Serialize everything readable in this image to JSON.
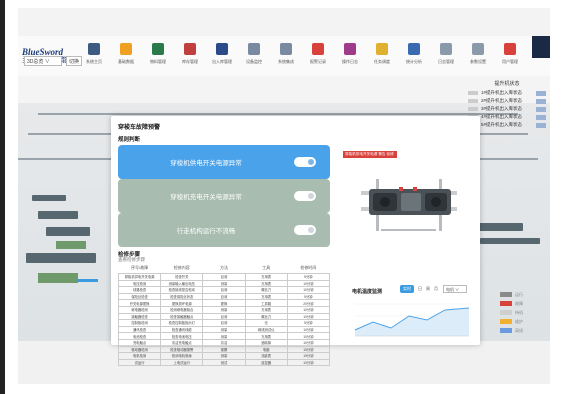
{
  "app": {
    "logo_line1": "BlueSword",
    "logo_line2": "兰 剑 智 能"
  },
  "toolbar": [
    {
      "label": "系统主页",
      "icon": "factory-icon",
      "color": "#3d5a80"
    },
    {
      "label": "基础数据",
      "icon": "sun-icon",
      "color": "#f0a020"
    },
    {
      "label": "物料管理",
      "icon": "tools-icon",
      "color": "#2a7a4a"
    },
    {
      "label": "库存管理",
      "icon": "wrench-icon",
      "color": "#c04040"
    },
    {
      "label": "出入库管理",
      "icon": "robot-icon",
      "color": "#2a4a8a"
    },
    {
      "label": "设备监控",
      "icon": "document-icon",
      "color": "#7a8aa0"
    },
    {
      "label": "系统集成",
      "icon": "file-icon",
      "color": "#7a8aa0"
    },
    {
      "label": "报警记录",
      "icon": "alert-icon",
      "color": "#d9413b"
    },
    {
      "label": "操作日志",
      "icon": "log-icon",
      "color": "#a03a8a"
    },
    {
      "label": "任务调度",
      "icon": "bulb-icon",
      "color": "#e0b030"
    },
    {
      "label": "统计分析",
      "icon": "grid-icon",
      "color": "#3a6ab0"
    },
    {
      "label": "日志管理",
      "icon": "page-icon",
      "color": "#8a9aaa"
    },
    {
      "label": "参数设置",
      "icon": "clipboard-icon",
      "color": "#8a9aaa"
    },
    {
      "label": "用户管理",
      "icon": "users-icon",
      "color": "#d9413b"
    }
  ],
  "selectors": {
    "scene": "3D总览",
    "view": "切换"
  },
  "legend_top": {
    "title": "提升机状态",
    "rows": [
      "1#提升机出入库状态",
      "2#提升机出入库状态",
      "3#提升机出入库状态",
      "4#提升机出入库状态",
      "5#提升机出入库状态"
    ]
  },
  "legend_bottom": [
    {
      "label": "运行",
      "color": "#8a8a8a"
    },
    {
      "label": "故障",
      "color": "#d9413b"
    },
    {
      "label": "待机",
      "color": "#cfcfcf"
    },
    {
      "label": "维护",
      "color": "#f0b030"
    },
    {
      "label": "离线",
      "color": "#6a9be0"
    }
  ],
  "modal": {
    "title": "穿梭车故障预警",
    "rules_title": "规则判断",
    "rules": [
      {
        "label": "穿梭机供电开关电源异常",
        "color": "#4aa3ea",
        "on": true
      },
      {
        "label": "穿梭机充电开关电源异常",
        "color": "#a9bcb0",
        "on": false
      },
      {
        "label": "行走机构运行不流畅",
        "color": "#a9bcb0",
        "on": false
      }
    ],
    "steps_title": "检修步骤",
    "steps_sub": "查看检修步骤",
    "table_headers": [
      "序号/故障",
      "检修内容",
      "方法",
      "工具",
      "检修时间"
    ],
    "table_rows": [
      [
        "穿梭机供电开关电源",
        "检查开关",
        "目测",
        "万用表",
        "5分钟"
      ],
      [
        "电压检测",
        "测量输入输出电压",
        "测量",
        "万用表",
        "10分钟"
      ],
      [
        "线路检查",
        "检查接线是否松动",
        "目测",
        "螺丝刀",
        "10分钟"
      ],
      [
        "保险丝检查",
        "检查保险丝状态",
        "目测",
        "万用表",
        "5分钟"
      ],
      [
        "开关电源更换",
        "更换损坏电源",
        "更换",
        "工具箱",
        "20分钟"
      ],
      [
        "继电器检测",
        "检测继电器吸合",
        "测量",
        "万用表",
        "10分钟"
      ],
      [
        "接触器检查",
        "检查接触器触点",
        "目测",
        "螺丝刀",
        "10分钟"
      ],
      [
        "控制板检测",
        "检查控制板指示灯",
        "目测",
        "无",
        "5分钟"
      ],
      [
        "通讯检查",
        "检查通讯线缆",
        "测量",
        "网线测试仪",
        "10分钟"
      ],
      [
        "电池检查",
        "检查电池电压",
        "测量",
        "万用表",
        "10分钟"
      ],
      [
        "充电触点",
        "清洁充电触点",
        "清洁",
        "酒精棉",
        "10分钟"
      ],
      [
        "驱动器检测",
        "检查驱动器报警",
        "观察",
        "电脑",
        "15分钟"
      ],
      [
        "电机检测",
        "检测电机绝缘",
        "测量",
        "兆欧表",
        "15分钟"
      ],
      [
        "试运行",
        "上电试运行",
        "测试",
        "遥控器",
        "10分钟"
      ]
    ],
    "object_tag": "穿梭机供电开关电源 警告 检修",
    "curve": {
      "title": "电机温度监测",
      "tabs": [
        "实时",
        "日",
        "周",
        "月"
      ],
      "select": "电机 ∨"
    }
  }
}
